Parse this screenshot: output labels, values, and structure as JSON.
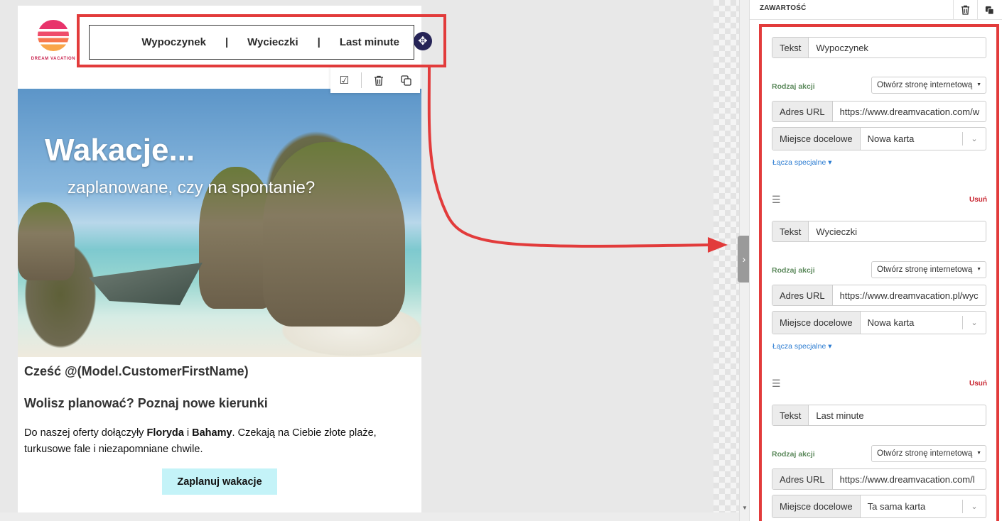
{
  "canvas": {
    "logo_text": "DREAM VACATION",
    "nav": {
      "items": [
        "Wypoczynek",
        "Wycieczki",
        "Last minute"
      ],
      "separator": "|"
    },
    "hero": {
      "title": "Wakacje...",
      "subtitle": "zaplanowane, czy na spontanie?"
    },
    "greeting": "Cześć @(Model.CustomerFirstName)",
    "heading": "Wolisz planować? Poznaj nowe kierunki",
    "paragraph": {
      "part1": "Do naszej oferty dołączyły ",
      "bold1": "Floryda",
      "part2": " i ",
      "bold2": "Bahamy",
      "part3": ". Czekają na Ciebie złote plaże, turkusowe fale i niezapomniane chwile."
    },
    "cta_label": "Zaplanuj wakacje"
  },
  "panel": {
    "title": "ZAWARTOŚĆ",
    "items": [
      {
        "text_label": "Tekst",
        "text_value": "Wypoczynek",
        "action_label": "Rodzaj akcji",
        "action_value": "Otwórz stronę internetową",
        "url_label": "Adres URL",
        "url_value": "https://www.dreamvacation.com/w",
        "target_label": "Miejsce docelowe",
        "target_value": "Nowa karta",
        "special_links": "Łącza specjalne"
      },
      {
        "text_label": "Tekst",
        "text_value": "Wycieczki",
        "action_label": "Rodzaj akcji",
        "action_value": "Otwórz stronę internetową",
        "url_label": "Adres URL",
        "url_value": "https://www.dreamvacation.pl/wyc",
        "target_label": "Miejsce docelowe",
        "target_value": "Nowa karta",
        "special_links": "Łącza specjalne",
        "remove_label": "Usuń"
      },
      {
        "text_label": "Tekst",
        "text_value": "Last minute",
        "action_label": "Rodzaj akcji",
        "action_value": "Otwórz stronę internetową",
        "url_label": "Adres URL",
        "url_value": "https://www.dreamvacation.com/l",
        "target_label": "Miejsce docelowe",
        "target_value": "Ta sama karta",
        "remove_label": "Usuń"
      }
    ]
  },
  "colors": {
    "highlight": "#e23b3b",
    "cta_bg": "#c4f3f8",
    "move_button": "#262457",
    "link": "#2a7bd1",
    "remove": "#c8232e"
  },
  "icons": {
    "move": "move-icon",
    "check": "checkbox-icon",
    "trash": "trash-icon",
    "duplicate": "duplicate-icon",
    "drag": "drag-handle-icon",
    "chevron": "chevron-down-icon"
  }
}
